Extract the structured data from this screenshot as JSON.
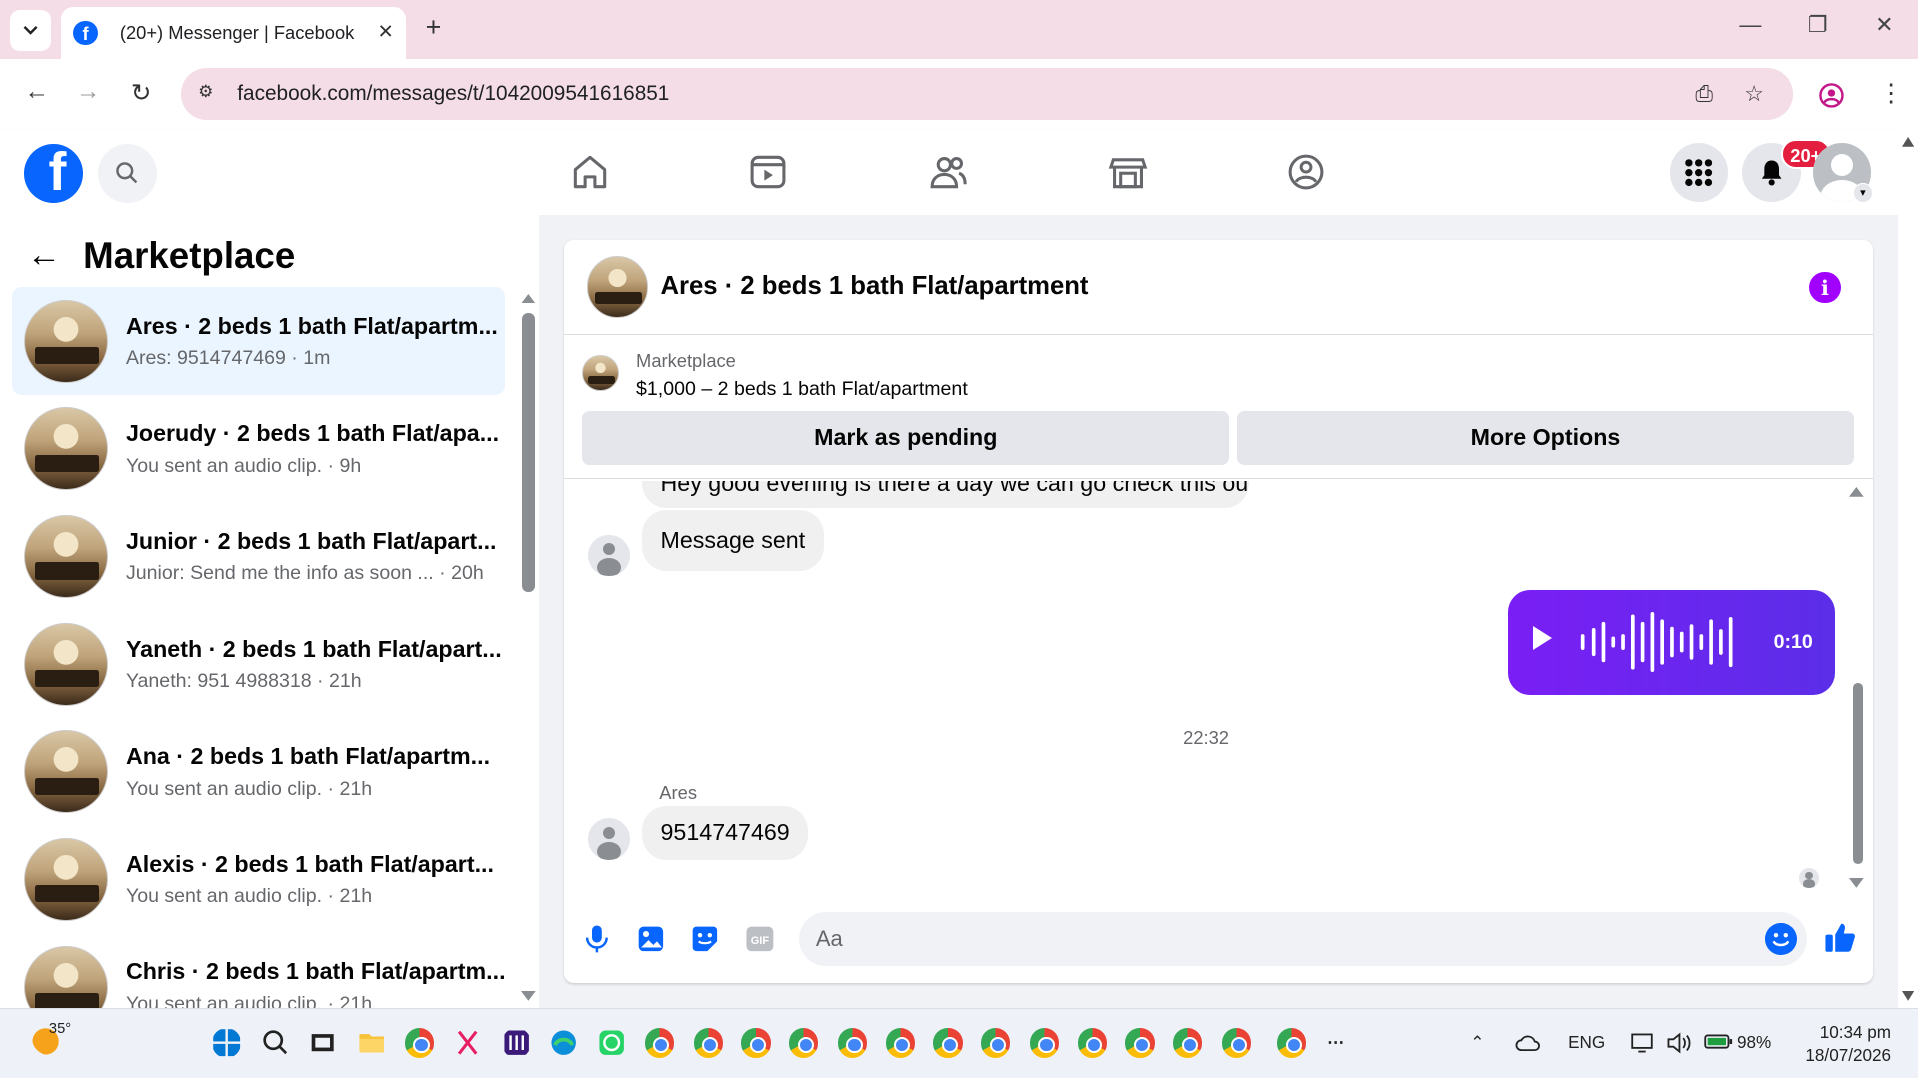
{
  "browser": {
    "tab_title": "(20+) Messenger | Facebook",
    "url": "facebook.com/messages/t/1042009541616851"
  },
  "header": {
    "notification_badge": "20+"
  },
  "sidebar": {
    "title": "Marketplace",
    "conversations": [
      {
        "name": "Ares · 2 beds 1 bath Flat/apartm...",
        "preview": "Ares: 9514747469 · 1m"
      },
      {
        "name": "Joerudy · 2 beds 1 bath Flat/apa...",
        "preview": "You sent an audio clip. · 9h"
      },
      {
        "name": "Junior · 2 beds 1 bath Flat/apart...",
        "preview": "Junior: Send me the info as soon ...  · 20h"
      },
      {
        "name": "Yaneth · 2 beds 1 bath Flat/apart...",
        "preview": "Yaneth: 951 4988318 · 21h"
      },
      {
        "name": "Ana · 2 beds 1 bath Flat/apartm...",
        "preview": "You sent an audio clip. · 21h"
      },
      {
        "name": "Alexis · 2 beds 1 bath Flat/apart...",
        "preview": "You sent an audio clip. · 21h"
      },
      {
        "name": "Chris · 2 beds 1 bath Flat/apartm...",
        "preview": "You sent an audio clip. · 21h"
      }
    ]
  },
  "chat": {
    "title": "Ares · 2 beds 1 bath Flat/apartment",
    "listing_source": "Marketplace",
    "listing": "$1,000 – 2 beds 1 bath Flat/apartment",
    "mark_pending": "Mark as pending",
    "more_options": "More Options",
    "msg_partial": "Hey good evening is there a day we can go check this out",
    "msg_sent": "Message sent",
    "audio_duration": "0:10",
    "timestamp": "22:32",
    "sender": "Ares",
    "msg_number": "9514747469",
    "composer_placeholder": "Aa"
  },
  "taskbar": {
    "temperature": "35°",
    "language": "ENG",
    "battery": "98%",
    "time": "10:34 pm",
    "date": "18/07/2026"
  },
  "colors": {
    "fb_blue": "#0866ff",
    "audio_purple": "#6e1df0",
    "info_purple": "#a100ff"
  }
}
